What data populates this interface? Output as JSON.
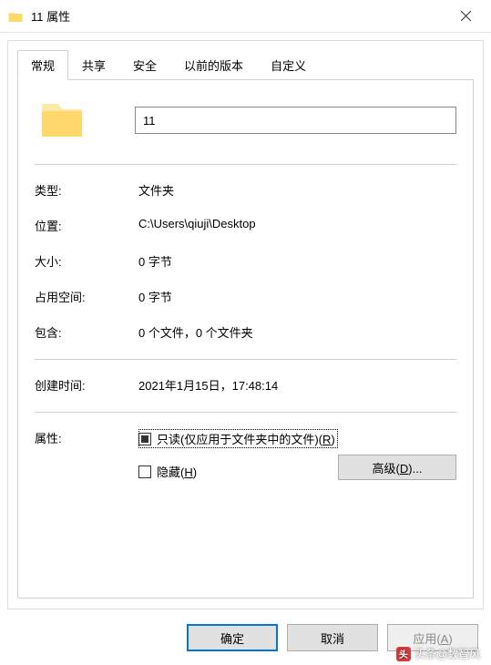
{
  "titlebar": {
    "title": "11 属性"
  },
  "tabs": {
    "general": "常规",
    "sharing": "共享",
    "security": "安全",
    "previous_versions": "以前的版本",
    "customize": "自定义"
  },
  "folder_name": "11",
  "properties": {
    "type_label": "类型:",
    "type_value": "文件夹",
    "location_label": "位置:",
    "location_value": "C:\\Users\\qiuji\\Desktop",
    "size_label": "大小:",
    "size_value": "0 字节",
    "size_on_disk_label": "占用空间:",
    "size_on_disk_value": "0 字节",
    "contains_label": "包含:",
    "contains_value": "0 个文件，0 个文件夹",
    "created_label": "创建时间:",
    "created_value": "2021年1月15日，17:48:14",
    "attributes_label": "属性:"
  },
  "attributes": {
    "readonly_prefix": "只读(仅应用于文件夹中的文件)(",
    "readonly_key": "R",
    "readonly_suffix": ")",
    "hidden_prefix": "隐藏(",
    "hidden_key": "H",
    "hidden_suffix": ")",
    "advanced_prefix": "高级(",
    "advanced_key": "D",
    "advanced_suffix": ")..."
  },
  "buttons": {
    "ok": "确定",
    "cancel": "取消",
    "apply_prefix": "应用(",
    "apply_key": "A",
    "apply_suffix": ")"
  },
  "watermark": {
    "text": "头条@数智风"
  }
}
